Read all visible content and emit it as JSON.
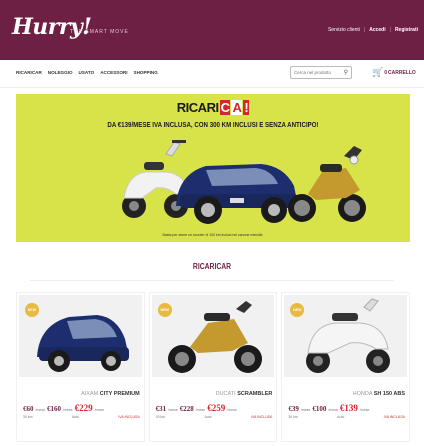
{
  "header": {
    "logo": "Hurry!",
    "tagline": "THE SMART MOVE",
    "links": [
      "Servizio clienti",
      "Accedi",
      "Registrati"
    ]
  },
  "nav": {
    "items": [
      "RICARICAR",
      "NOLEGGIO",
      "USATO",
      "ACCESSORI",
      "SHOPPING"
    ],
    "search_placeholder": "Cerca nel prodotto",
    "cart_label": "CARRELLO",
    "cart_count": "0"
  },
  "hero": {
    "title": "RICARI",
    "title_boxes": [
      "C",
      "A",
      "!"
    ],
    "subtitle": "DA €139/MESE IVA INCLUSA, CON 300 KM INCLUSI E SENZA ANTICIPO!",
    "note": "Basta per avere un scooter di 100 km inclusi nel canone mensile."
  },
  "section": {
    "title": "RICARICAR"
  },
  "products": [
    {
      "badge": "NEW",
      "brand": "AIXAM",
      "model": "CITY PREMIUM",
      "prices": [
        "€60",
        "€160",
        "€229"
      ],
      "per": "/mese",
      "sub": [
        "30 km",
        "Auto",
        "IVA INCLUSA"
      ]
    },
    {
      "badge": "NEW",
      "brand": "DUCATI",
      "model": "SCRAMBLER",
      "prices": [
        "€31",
        "€228",
        "€259"
      ],
      "per": "/mese",
      "sub": [
        "30 km",
        "Auto",
        "IVA INCLUSA"
      ]
    },
    {
      "badge": "NEW",
      "brand": "HONDA",
      "model": "SH 150 ABS",
      "prices": [
        "€39",
        "€100",
        "€139"
      ],
      "per": "/mese",
      "sub": [
        "30 km",
        "Auto",
        "IVA INCLUSA"
      ]
    }
  ],
  "colors": {
    "brand": "#6e1f44",
    "accent_yellow": "#d8e34a",
    "price_red": "#d8262e",
    "badge": "#e9b940"
  }
}
